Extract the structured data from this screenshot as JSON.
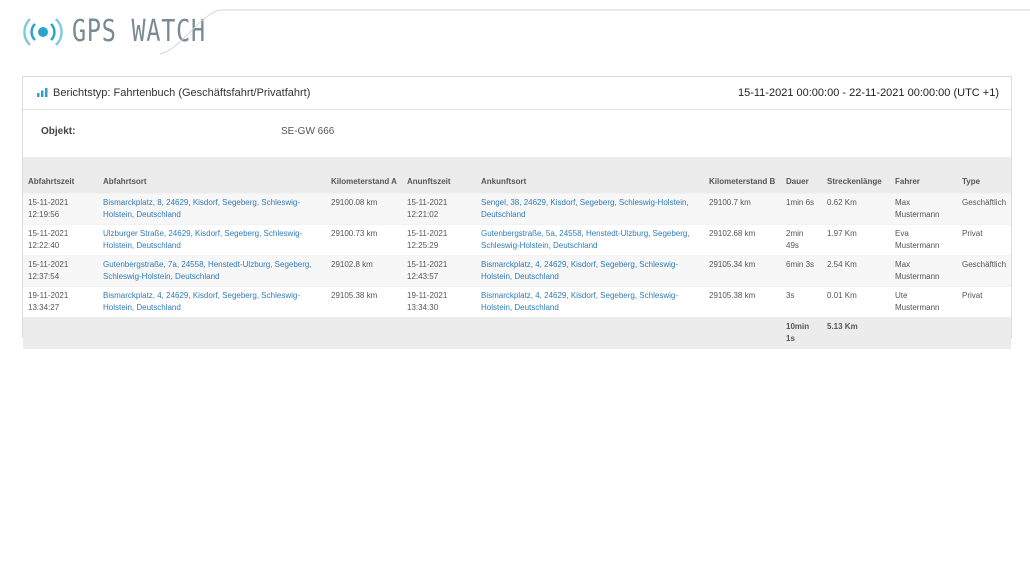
{
  "app": {
    "logo_text": "GPS WATCH",
    "logo_icon": "signal-broadcast-icon",
    "accent_color": "#2aa5c9"
  },
  "report": {
    "icon": "bar-chart-icon",
    "title": "Berichtstyp: Fahrtenbuch (Geschäftsfahrt/Privatfahrt)",
    "date_range": "15-11-2021 00:00:00 - 22-11-2021 00:00:00 (UTC +1)",
    "object_label": "Objekt:",
    "object_value": "SE-GW 666"
  },
  "table": {
    "headers": [
      "Abfahrtszeit",
      "Abfahrtsort",
      "Kilometerstand A",
      "Anunftszeit",
      "Ankunftsort",
      "Kilometerstand B",
      "Dauer",
      "Streckenlänge",
      "Fahrer",
      "Type"
    ],
    "rows": [
      [
        "15-11-2021 12:19:56",
        "Bismarckplatz, 8, 24629, Kisdorf, Segeberg, Schleswig-Holstein, Deutschland",
        "29100.08 km",
        "15-11-2021 12:21:02",
        "Sengel, 38, 24629, Kisdorf, Segeberg, Schleswig-Holstein, Deutschland",
        "29100.7 km",
        "1min 6s",
        "0.62 Km",
        "Max Mustermann",
        "Geschäftlich"
      ],
      [
        "15-11-2021 12:22:40",
        "Ulzburger Straße, 24629, Kisdorf, Segeberg, Schleswig-Holstein, Deutschland",
        "29100.73 km",
        "15-11-2021 12:25:29",
        "Gutenbergstraße, 5a, 24558, Henstedt-Ulzburg, Segeberg, Schleswig-Holstein, Deutschland",
        "29102.68 km",
        "2min 49s",
        "1.97 Km",
        "Eva Mustermann",
        "Privat"
      ],
      [
        "15-11-2021 12:37:54",
        "Gutenbergstraße, 7a, 24558, Henstedt-Ulzburg, Segeberg, Schleswig-Holstein, Deutschland",
        "29102.8 km",
        "15-11-2021 12:43:57",
        "Bismarckplatz, 4, 24629, Kisdorf, Segeberg, Schleswig-Holstein, Deutschland",
        "29105.34 km",
        "6min 3s",
        "2.54 Km",
        "Max Mustermann",
        "Geschäftlich"
      ],
      [
        "19-11-2021 13:34:27",
        "Bismarckplatz, 4, 24629, Kisdorf, Segeberg, Schleswig-Holstein, Deutschland",
        "29105.38 km",
        "19-11-2021 13:34:30",
        "Bismarckplatz, 4, 24629, Kisdorf, Segeberg, Schleswig-Holstein, Deutschland",
        "29105.38 km",
        "3s",
        "0.01 Km",
        "Ute Mustermann",
        "Privat"
      ]
    ],
    "totals": {
      "duration": "10min 1s",
      "distance": "5.13 Km"
    }
  }
}
